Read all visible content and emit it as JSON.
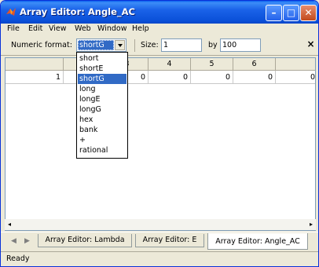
{
  "window": {
    "title": "Array Editor: Angle_AC",
    "accent": "#0A50D8",
    "buttons": {
      "minimize": "–",
      "maximize": "□",
      "close": "✕"
    }
  },
  "menu": {
    "items": [
      "File",
      "Edit",
      "View",
      "Web",
      "Window",
      "Help"
    ]
  },
  "toolbar": {
    "numeric_format_label": "Numeric format:",
    "numeric_format_value": "shortG",
    "size_label": "Size:",
    "size_rows": "1",
    "by_label": "by",
    "size_cols": "100",
    "close_label": "×"
  },
  "dropdown": {
    "options": [
      "short",
      "shortE",
      "shortG",
      "long",
      "longE",
      "longG",
      "hex",
      "bank",
      "+",
      "rational"
    ],
    "selected": "shortG"
  },
  "grid": {
    "column_headers": [
      "2",
      "3",
      "4",
      "5",
      "6"
    ],
    "row_header": "1",
    "cells": [
      "0",
      "0",
      "0",
      "0",
      "0",
      "0"
    ]
  },
  "tabs": {
    "items": [
      "Array Editor: Lambda",
      "Array Editor: E",
      "Array Editor: Angle_AC"
    ],
    "active": "Array Editor: Angle_AC"
  },
  "status": {
    "text": "Ready"
  },
  "icons": {
    "app": "matlab-logo-icon",
    "tab_left": "chevron-left-icon",
    "tab_right": "chevron-right-icon",
    "scroll_left": "scroll-left-icon",
    "scroll_right": "scroll-right-icon"
  }
}
